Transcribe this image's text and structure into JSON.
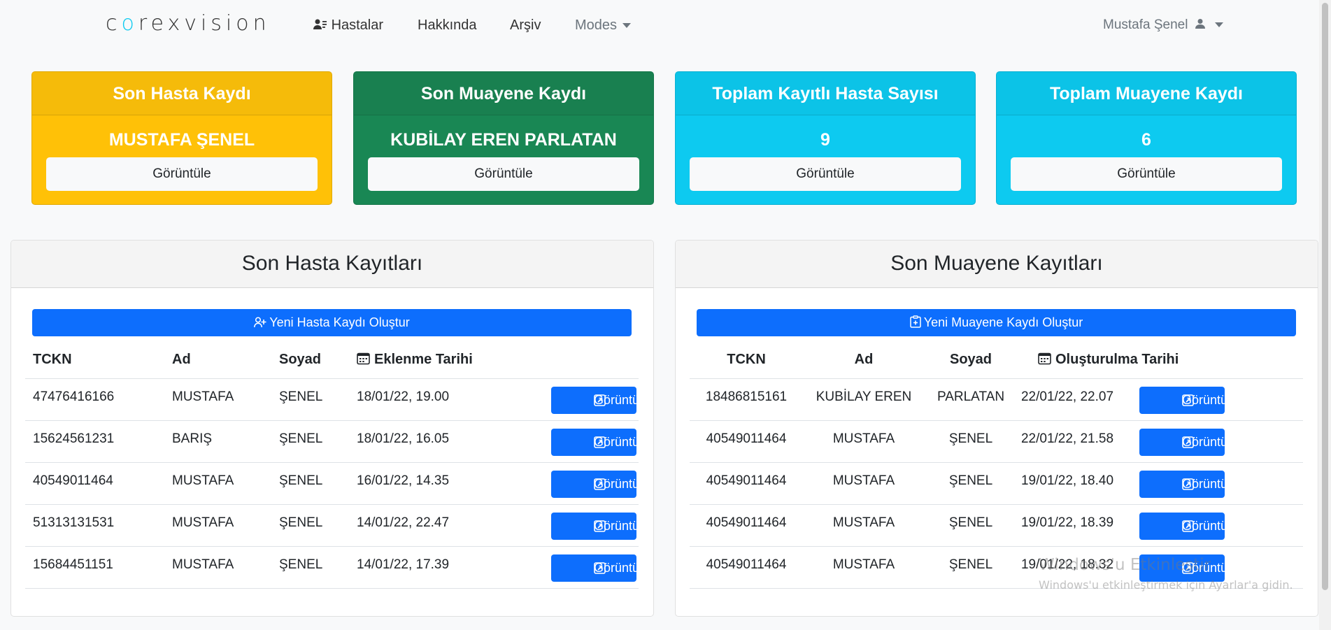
{
  "navbar": {
    "brand": "corexvision",
    "links": [
      "Hastalar",
      "Hakkında",
      "Arşiv",
      "Modes"
    ],
    "user": "Mustafa Şenel"
  },
  "cards": [
    {
      "title": "Son Hasta Kaydı",
      "value": "MUSTAFA ŞENEL",
      "button": "Görüntüle",
      "color": "#ffc107"
    },
    {
      "title": "Son Muayene Kaydı",
      "value": "KUBİLAY EREN PARLATAN",
      "button": "Görüntüle",
      "color": "#198754"
    },
    {
      "title": "Toplam Kayıtlı Hasta Sayısı",
      "value": "9",
      "button": "Görüntüle",
      "color": "#0dcaf0"
    },
    {
      "title": "Toplam Muayene Kaydı",
      "value": "6",
      "button": "Görüntüle",
      "color": "#0dcaf0"
    }
  ],
  "patients": {
    "title": "Son Hasta Kayıtları",
    "new_button": "Yeni Hasta Kaydı Oluştur",
    "headers": [
      "TCKN",
      "Ad",
      "Soyad",
      "Eklenme Tarihi"
    ],
    "view_label": "Görüntüle",
    "rows": [
      [
        "47476416166",
        "MUSTAFA",
        "ŞENEL",
        "18/01/22, 19.00"
      ],
      [
        "15624561231",
        "BARIŞ",
        "ŞENEL",
        "18/01/22, 16.05"
      ],
      [
        "40549011464",
        "MUSTAFA",
        "ŞENEL",
        "16/01/22, 14.35"
      ],
      [
        "51313131531",
        "MUSTAFA",
        "ŞENEL",
        "14/01/22, 22.47"
      ],
      [
        "15684451151",
        "MUSTAFA",
        "ŞENEL",
        "14/01/22, 17.39"
      ]
    ]
  },
  "exams": {
    "title": "Son Muayene Kayıtları",
    "new_button": "Yeni Muayene Kaydı Oluştur",
    "headers": [
      "TCKN",
      "Ad",
      "Soyad",
      "Oluşturulma Tarihi"
    ],
    "view_label": "Görüntüle",
    "rows": [
      [
        "18486815161",
        "KUBİLAY EREN",
        "PARLATAN",
        "22/01/22, 22.07"
      ],
      [
        "40549011464",
        "MUSTAFA",
        "ŞENEL",
        "22/01/22, 21.58"
      ],
      [
        "40549011464",
        "MUSTAFA",
        "ŞENEL",
        "19/01/22, 18.40"
      ],
      [
        "40549011464",
        "MUSTAFA",
        "ŞENEL",
        "19/01/22, 18.39"
      ],
      [
        "40549011464",
        "MUSTAFA",
        "ŞENEL",
        "19/01/22, 18.32"
      ]
    ]
  },
  "watermark": {
    "line1": "Windows'u Etkinleştir",
    "line2": "Windows'u etkinleştirmek için Ayarlar'a gidin."
  }
}
